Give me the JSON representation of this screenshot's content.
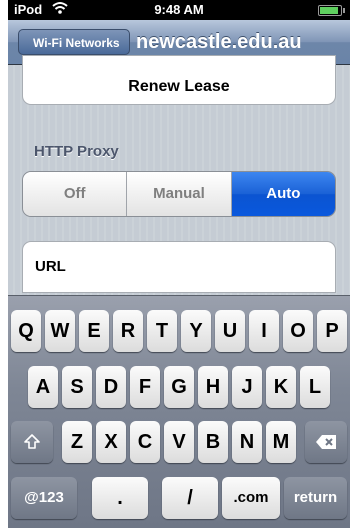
{
  "status_bar": {
    "carrier": "iPod",
    "time": "9:48 AM"
  },
  "nav": {
    "back_label": "Wi-Fi Networks",
    "title": "newcastle.edu.au"
  },
  "renew_lease_label": "Renew Lease",
  "http_proxy": {
    "section_title": "HTTP Proxy",
    "options": [
      "Off",
      "Manual",
      "Auto"
    ],
    "selected": "Auto",
    "url_label": "URL"
  },
  "keyboard": {
    "row1": [
      "Q",
      "W",
      "E",
      "R",
      "T",
      "Y",
      "U",
      "I",
      "O",
      "P"
    ],
    "row2": [
      "A",
      "S",
      "D",
      "F",
      "G",
      "H",
      "J",
      "K",
      "L"
    ],
    "row3": [
      "Z",
      "X",
      "C",
      "V",
      "B",
      "N",
      "M"
    ],
    "bottom": {
      "numbers": "@123",
      "dot": ".",
      "slash": "/",
      "dotcom": ".com",
      "return": "return"
    }
  }
}
